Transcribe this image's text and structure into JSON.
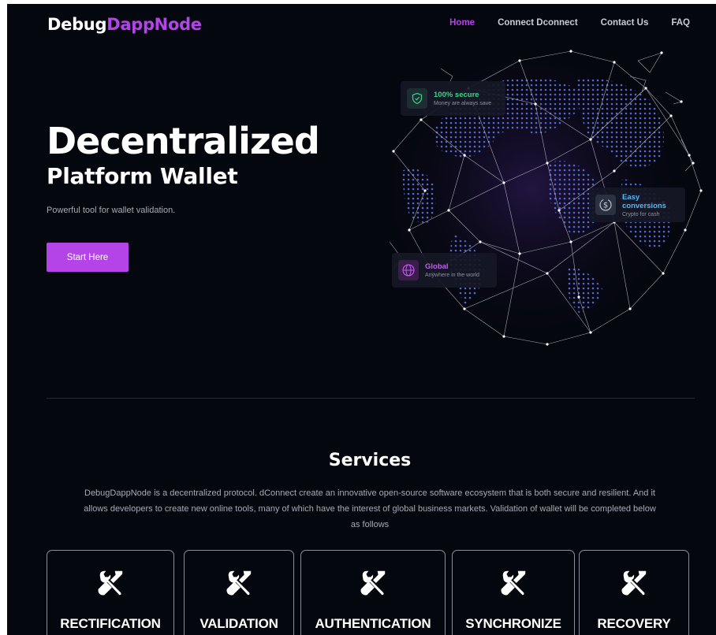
{
  "brand": {
    "part1": "Debug",
    "part2": "DappNode"
  },
  "nav": {
    "home": "Home",
    "connect": "Connect Dconnect",
    "contact": "Contact Us",
    "faq": "FAQ"
  },
  "hero": {
    "title": "Decentralized",
    "subtitle": "Platform Wallet",
    "description": "Powerful tool for wallet validation.",
    "cta": "Start Here"
  },
  "cards": {
    "secure": {
      "title": "100% secure",
      "subtitle": "Money are always save",
      "icon": "shield-icon"
    },
    "conversions": {
      "title": "Easy conversions",
      "subtitle": "Crypto for cash",
      "icon": "dollar-cycle-icon"
    },
    "global": {
      "title": "Global",
      "subtitle": "Anywhere in the world",
      "icon": "globe-icon"
    }
  },
  "services": {
    "title": "Services",
    "description": "DebugDappNode is a decentralized protocol. dConnect create an innovative open-source software ecosystem that is both secure and resilient. And it allows developers to create new online tools, many of which have the interest of global business markets. Validation of wallet will be completed below as follows",
    "items": [
      {
        "label": "RECTIFICATION",
        "icon": "tools-icon"
      },
      {
        "label": "VALIDATION",
        "icon": "tools-icon"
      },
      {
        "label": "AUTHENTICATION",
        "icon": "tools-icon"
      },
      {
        "label": "SYNCHRONIZE",
        "icon": "tools-icon"
      },
      {
        "label": "RECOVERY",
        "icon": "tools-icon"
      }
    ]
  },
  "colors": {
    "background": "#05070f",
    "accent": "#b443e8",
    "secure": "#3fd08c",
    "conversions": "#52b9f5"
  }
}
